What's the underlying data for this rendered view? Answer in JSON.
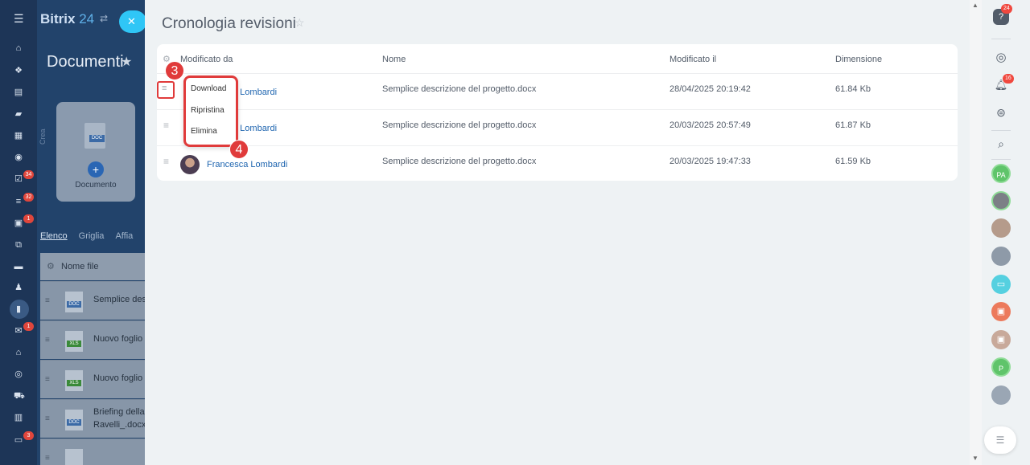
{
  "colors": {
    "accent": "#2fc6f6",
    "highlight": "#e03b3b",
    "link": "#2066b0",
    "badge": "#f0483e"
  },
  "leftbar": {
    "icons": [
      "menu-icon",
      "home-icon",
      "feed-icon",
      "tasks-icon",
      "chat-icon",
      "calendar-icon",
      "drive-icon",
      "checklist-icon",
      "crm-icon",
      "contacts-icon",
      "workflow-icon",
      "shop-icon",
      "employees-icon",
      "documents-icon",
      "mail-icon",
      "store-icon",
      "target-icon",
      "cart-icon",
      "analytics-icon",
      "box-icon"
    ],
    "badges": {
      "tasks": "34",
      "crm": "32",
      "contacts": "1",
      "mail": "1",
      "box": "3"
    }
  },
  "background": {
    "logo_name": "Bitrix",
    "logo_num": "24",
    "page_title": "Documenti",
    "create_label": "Crea",
    "card_doc_label": "DOC",
    "card_label": "Documento",
    "tabs": [
      "Elenco",
      "Griglia",
      "Affia"
    ],
    "column_file": "Nome file",
    "rows": [
      {
        "type": "DOC",
        "name": "Semplice desc"
      },
      {
        "type": "XLS",
        "name": "Nuovo foglio"
      },
      {
        "type": "XLS",
        "name": "Nuovo foglio"
      },
      {
        "type": "DOC",
        "name1": "Briefing della",
        "name2": "Ravelli_.docx"
      }
    ]
  },
  "panel": {
    "title": "Cronologia revisioni",
    "columns": {
      "modified_by": "Modificato da",
      "name": "Nome",
      "modified_at": "Modificato il",
      "size": "Dimensione"
    },
    "rows": [
      {
        "user": "a Lombardi",
        "file": "Semplice descrizione del progetto.docx",
        "date": "28/04/2025 20:19:42",
        "size": "61.84 Kb"
      },
      {
        "user": "a Lombardi",
        "file": "Semplice descrizione del progetto.docx",
        "date": "20/03/2025 20:57:49",
        "size": "61.87 Kb"
      },
      {
        "user": "Francesca Lombardi",
        "file": "Semplice descrizione del progetto.docx",
        "date": "20/03/2025 19:47:33",
        "size": "61.59 Kb"
      }
    ],
    "menu": {
      "download": "Download",
      "restore": "Ripristina",
      "delete": "Elimina"
    },
    "steps": {
      "one": "3",
      "two": "4"
    }
  },
  "rightbar": {
    "help_badge": "24",
    "notif_badge": "16",
    "avatars": [
      "PA",
      "",
      "",
      "",
      "",
      "",
      "",
      "P",
      ""
    ]
  }
}
